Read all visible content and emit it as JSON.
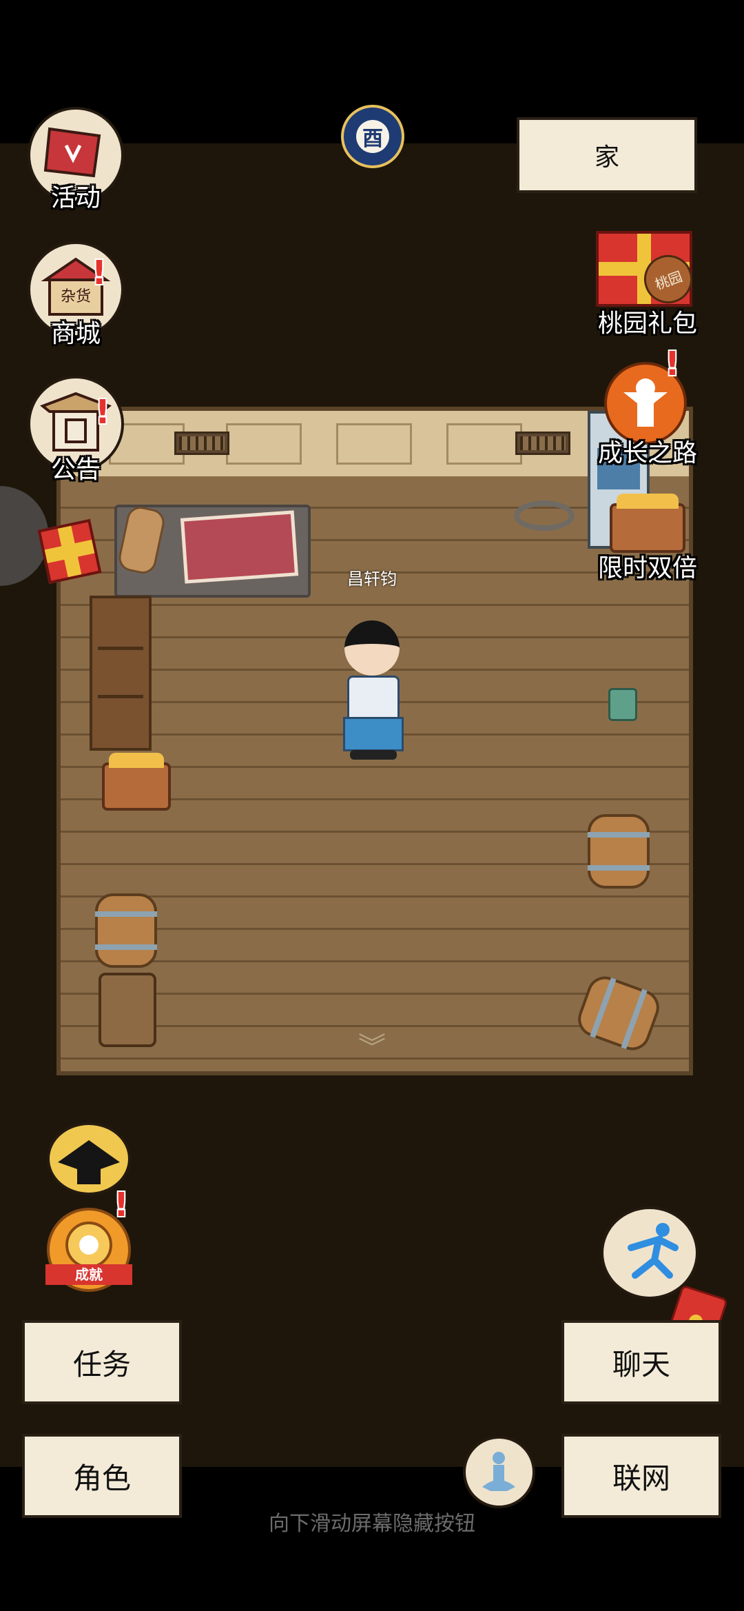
{
  "location": {
    "label": "家"
  },
  "time": {
    "symbol": "酉"
  },
  "left_icons": {
    "events": {
      "label": "活动"
    },
    "shop": {
      "label": "商城",
      "sign": "杂货"
    },
    "notice": {
      "label": "公告"
    }
  },
  "right_icons": {
    "peach_gift": {
      "label": "桃园礼包",
      "tag": "桃园"
    },
    "growth": {
      "label": "成长之路"
    },
    "double": {
      "label": "限时双倍"
    }
  },
  "achievement": {
    "ribbon": "成就"
  },
  "player": {
    "name": "昌轩钧"
  },
  "alert_mark": "!",
  "scroll_arrows": "︾",
  "menu": {
    "tasks": "任务",
    "character": "角色",
    "chat": "聊天",
    "network": "联网"
  },
  "hint": "向下滑动屏幕隐藏按钮",
  "colors": {
    "background": "#1e160a",
    "button_bg": "#f3ebd8",
    "alert": "#e5322d",
    "floor": "#8a6d48"
  }
}
